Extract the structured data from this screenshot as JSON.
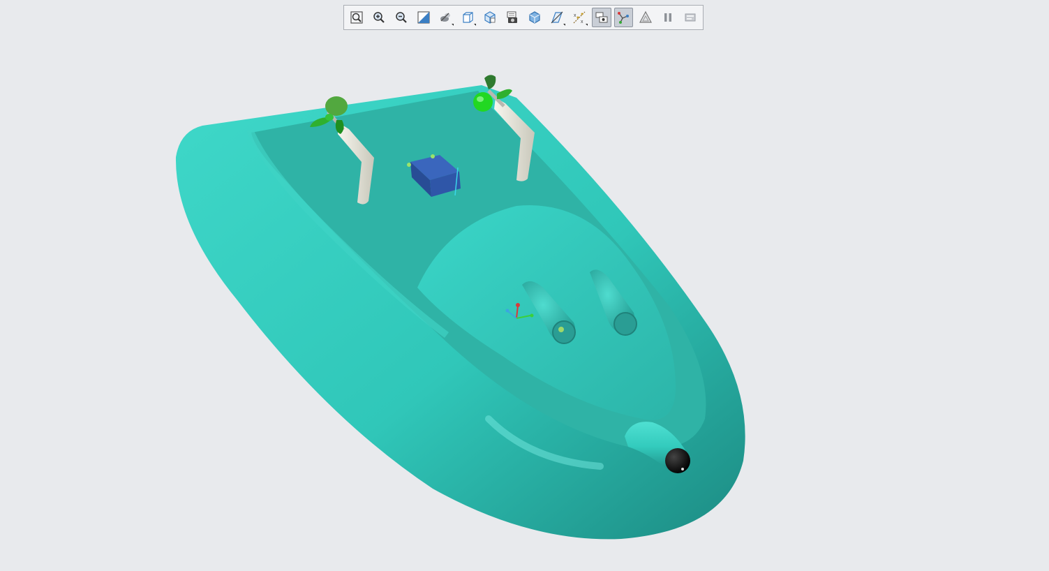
{
  "app": {
    "viewport_background": "#e8eaed"
  },
  "toolbar": {
    "buttons": [
      {
        "name": "refit-button",
        "icon": "refit-icon",
        "active": false
      },
      {
        "name": "zoom-in-button",
        "icon": "zoom-in-icon",
        "active": false
      },
      {
        "name": "zoom-out-button",
        "icon": "zoom-out-icon",
        "active": false
      },
      {
        "name": "repaint-button",
        "icon": "repaint-icon",
        "active": false
      },
      {
        "name": "display-style-button",
        "icon": "display-style-icon",
        "active": false
      },
      {
        "name": "saved-orientations-button",
        "icon": "saved-view-icon",
        "active": false
      },
      {
        "name": "view-manager-button",
        "icon": "view-manager-icon",
        "active": false
      },
      {
        "name": "perspective-button",
        "icon": "camera-icon",
        "active": false
      },
      {
        "name": "section-button",
        "icon": "section-icon",
        "active": false
      },
      {
        "name": "datum-display-button",
        "icon": "datum-plane-icon",
        "active": false
      },
      {
        "name": "annotation-display-button",
        "icon": "datum-axis-icon",
        "active": false
      },
      {
        "name": "spin-center-button",
        "icon": "spin-center-icon",
        "active": true
      },
      {
        "name": "coordinate-display-button",
        "icon": "coordinate-system-icon",
        "active": true
      },
      {
        "name": "appearance-button",
        "icon": "appearance-icon",
        "active": false
      },
      {
        "name": "pause-button",
        "icon": "pause-icon",
        "active": false
      },
      {
        "name": "annotation-button",
        "icon": "annotation-icon",
        "active": false
      }
    ]
  },
  "model": {
    "hull_color": "#33c9bb",
    "deck_color": "#2fb3a6",
    "motor_color": "#2f56a8",
    "propeller_color": "#36c23a",
    "shaft_color": "#ecebe0",
    "nozzle_color": "#111111"
  }
}
